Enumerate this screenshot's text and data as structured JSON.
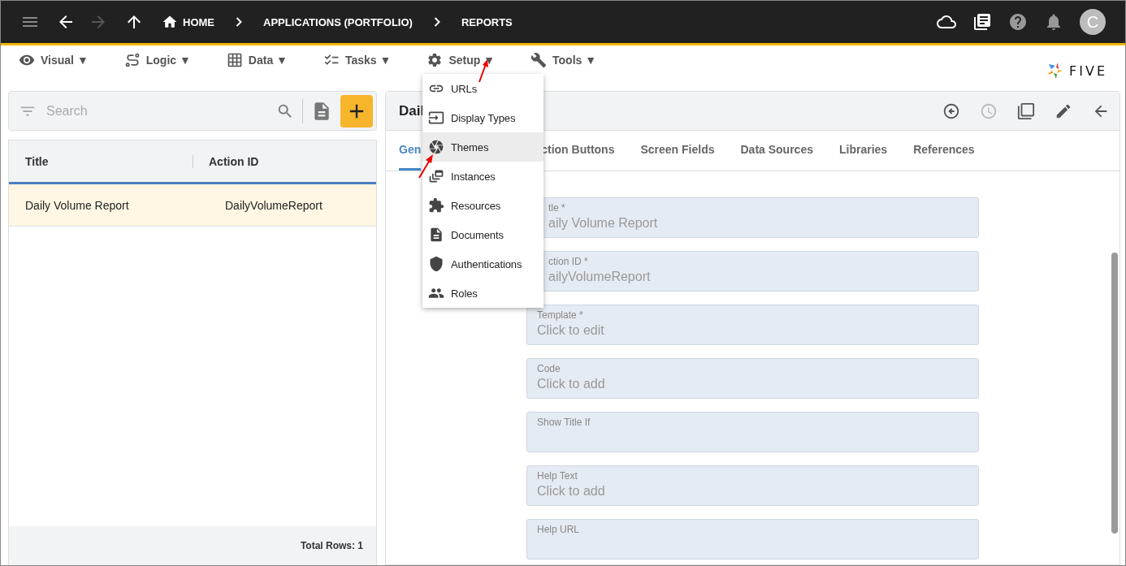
{
  "nav": {
    "breadcrumbs": [
      {
        "label": "HOME",
        "kind": "home"
      },
      {
        "label": "APPLICATIONS (PORTFOLIO)",
        "kind": "plain"
      },
      {
        "label": "REPORTS",
        "kind": "plain"
      }
    ],
    "avatar": "C"
  },
  "menubar": [
    {
      "label": "Visual",
      "caret": "▼"
    },
    {
      "label": "Logic",
      "caret": "▼"
    },
    {
      "label": "Data",
      "caret": "▼"
    },
    {
      "label": "Tasks",
      "caret": "▼"
    },
    {
      "label": "Setup",
      "caret": "▼"
    },
    {
      "label": "Tools",
      "caret": "▼"
    }
  ],
  "logo": "FIVE",
  "search": {
    "placeholder": "Search"
  },
  "list": {
    "columns": [
      "Title",
      "Action ID"
    ],
    "rows": [
      {
        "cells": [
          "Daily Volume Report",
          "DailyVolumeReport"
        ],
        "selected": true
      }
    ],
    "footer": "Total Rows: 1"
  },
  "form": {
    "title": "Dail",
    "tabs": [
      {
        "label": "Gen",
        "selected": true
      },
      {
        "label": "ction Buttons",
        "selected": false
      },
      {
        "label": "Screen Fields",
        "selected": false
      },
      {
        "label": "Data Sources",
        "selected": false
      },
      {
        "label": "Libraries",
        "selected": false
      },
      {
        "label": "References",
        "selected": false
      }
    ],
    "fields": [
      {
        "label": "tle *",
        "value": "aily Volume Report"
      },
      {
        "label": "ction ID *",
        "value": "ailyVolumeReport"
      },
      {
        "label": "Template *",
        "placeholder": "Click to edit"
      },
      {
        "label": "Code",
        "placeholder": "Click to add"
      },
      {
        "label": "Show Title If"
      },
      {
        "label": "Help Text",
        "placeholder": "Click to add"
      },
      {
        "label": "Help URL"
      }
    ]
  },
  "dropdown": {
    "items": [
      {
        "label": "URLs",
        "highlighted": false
      },
      {
        "label": "Display Types",
        "highlighted": false
      },
      {
        "label": "Themes",
        "highlighted": true
      },
      {
        "label": "Instances",
        "highlighted": false
      },
      {
        "label": "Resources",
        "highlighted": false
      },
      {
        "label": "Documents",
        "highlighted": false
      },
      {
        "label": "Authentications",
        "highlighted": false
      },
      {
        "label": "Roles",
        "highlighted": false
      }
    ]
  }
}
